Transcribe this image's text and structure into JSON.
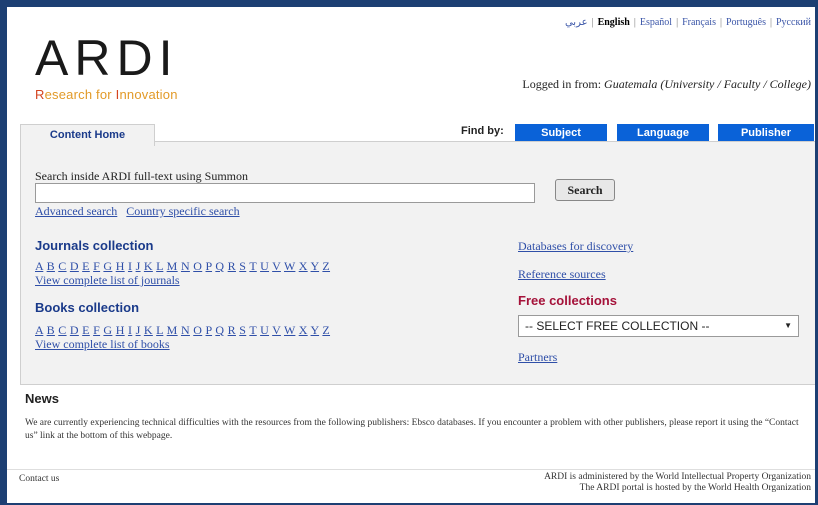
{
  "header": {
    "languages": [
      {
        "label": "عربي"
      },
      {
        "label": "English"
      },
      {
        "label": "Español"
      },
      {
        "label": "Français"
      },
      {
        "label": "Português"
      },
      {
        "label": "Русский"
      }
    ],
    "logo_text": "ARDI",
    "tagline_r": "R",
    "tagline_1": "esearch for ",
    "tagline_i": "I",
    "tagline_2": "nnovation",
    "logged_in_prefix": "Logged in from: ",
    "logged_in_place": "Guatemala (University / Faculty / College)"
  },
  "tabs": {
    "content_home": "Content Home",
    "find_by": "Find by:",
    "subject": "Subject",
    "language": "Language",
    "publisher": "Publisher"
  },
  "search": {
    "label": "Search inside ARDI full-text using Summon",
    "value": "",
    "button": "Search",
    "advanced": "Advanced search",
    "country": "Country specific search"
  },
  "journals": {
    "title": "Journals collection",
    "letters": [
      "A",
      "B",
      "C",
      "D",
      "E",
      "F",
      "G",
      "H",
      "I",
      "J",
      "K",
      "L",
      "M",
      "N",
      "O",
      "P",
      "Q",
      "R",
      "S",
      "T",
      "U",
      "V",
      "W",
      "X",
      "Y",
      "Z"
    ],
    "view_all": "View complete list of journals"
  },
  "books": {
    "title": "Books collection",
    "letters": [
      "A",
      "B",
      "C",
      "D",
      "E",
      "F",
      "G",
      "H",
      "I",
      "J",
      "K",
      "L",
      "M",
      "N",
      "O",
      "P",
      "Q",
      "R",
      "S",
      "T",
      "U",
      "V",
      "W",
      "X",
      "Y",
      "Z"
    ],
    "view_all": "View complete list of books"
  },
  "right_column": {
    "databases": "Databases for discovery",
    "reference": "Reference sources",
    "free_title": "Free collections",
    "free_select": "-- SELECT FREE COLLECTION --",
    "partners": "Partners"
  },
  "news": {
    "title": "News",
    "body": "We are currently experiencing technical difficulties with the resources from the following publishers: Ebsco databases. If you encounter a problem with other publishers, please report it using the “Contact us” link at the bottom of this webpage."
  },
  "footer": {
    "contact": "Contact us",
    "line1": "ARDI is administered by the World Intellectual Property Organization",
    "line2": "The ARDI portal is hosted by the World Health Organization"
  },
  "colors": {
    "frame": "#1d3f73",
    "find_button": "#0a62d8",
    "link": "#2f4fa8",
    "section_title": "#1a3a8a",
    "free_title": "#a5123a"
  }
}
